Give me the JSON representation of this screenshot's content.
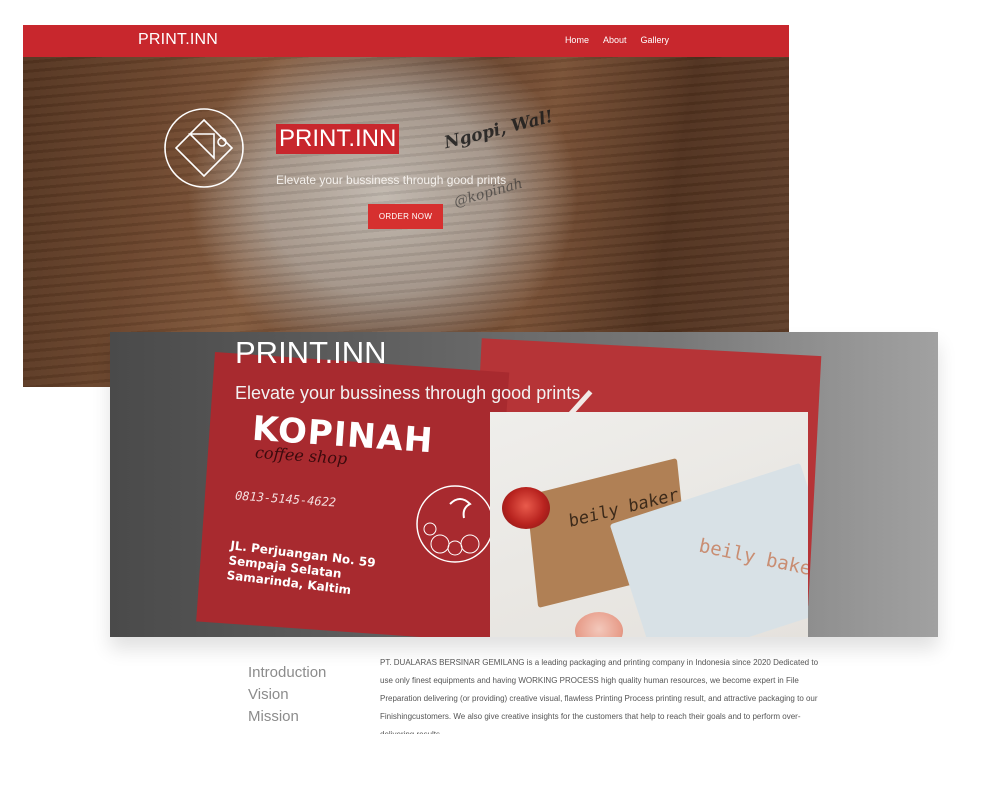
{
  "landing": {
    "brand": "PRINT.INN",
    "nav": [
      "Home",
      "About",
      "Gallery"
    ],
    "hero_title": "PRINT.INN",
    "hero_subtitle": "Elevate your bussiness through good prints",
    "order_button": "ORDER NOW",
    "cup_text": [
      "Ngopi, Wal!",
      "@kopinah"
    ],
    "accent_color": "#c8272d"
  },
  "gallery": {
    "title": "PRINT.INN",
    "subtitle": "Elevate your bussiness through good prints",
    "card": {
      "brand": "KOPINAH",
      "tagline": "coffee shop",
      "phone": "0813-5145-4622",
      "address_lines": [
        "JL. Perjuangan No. 59",
        "Sempaja Selatan",
        "Samarinda, Kaltim"
      ]
    },
    "box_label": "beily baker"
  },
  "about": {
    "tabs": [
      "Introduction",
      "Vision",
      "Mission"
    ],
    "text": "PT. DUALARAS BERSINAR GEMILANG is a leading packaging and printing company in Indonesia since 2020 Dedicated to use only finest equipments and having WORKING PROCESS high quality human resources, we become expert in File Preparation delivering (or providing) creative visual, flawless Printing Process printing result, and attractive packaging to our Finishingcustomers. We also give creative insights for the customers that help to reach their goals and to perform over-delivering results."
  }
}
